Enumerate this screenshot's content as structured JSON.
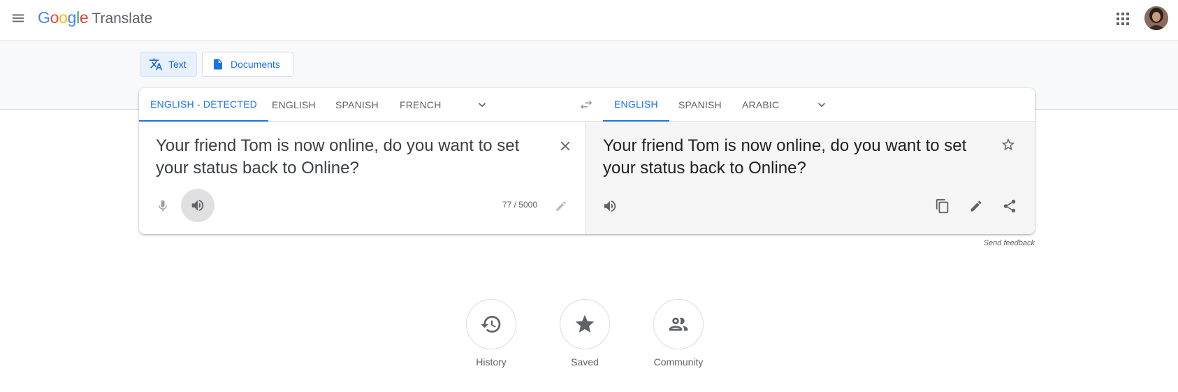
{
  "header": {
    "logo_google": "Google",
    "logo_product": "Translate",
    "icons": [
      "menu-icon",
      "apps-grid-icon"
    ]
  },
  "modes": [
    {
      "label": "Text",
      "icon": "translate-icon",
      "active": true
    },
    {
      "label": "Documents",
      "icon": "document-icon",
      "active": false
    }
  ],
  "source_langs": [
    {
      "label": "ENGLISH - DETECTED",
      "active": true
    },
    {
      "label": "ENGLISH",
      "active": false
    },
    {
      "label": "SPANISH",
      "active": false
    },
    {
      "label": "FRENCH",
      "active": false
    }
  ],
  "target_langs": [
    {
      "label": "ENGLISH",
      "active": true
    },
    {
      "label": "SPANISH",
      "active": false
    },
    {
      "label": "ARABIC",
      "active": false
    }
  ],
  "source": {
    "text": "Your friend Tom is now online, do you want to set your status back to Online?",
    "counter": "77 / 5000"
  },
  "target": {
    "text": "Your friend Tom is now online, do you want to set your status back to Online?"
  },
  "feedback_label": "Send feedback",
  "bottom_actions": [
    {
      "label": "History",
      "icon": "history-icon"
    },
    {
      "label": "Saved",
      "icon": "star-icon"
    },
    {
      "label": "Community",
      "icon": "community-icon"
    }
  ],
  "colors": {
    "accent": "#1a73e8",
    "google_blue": "#4285f4",
    "google_red": "#ea4335",
    "google_yellow": "#fbbc05",
    "google_green": "#34a853"
  }
}
